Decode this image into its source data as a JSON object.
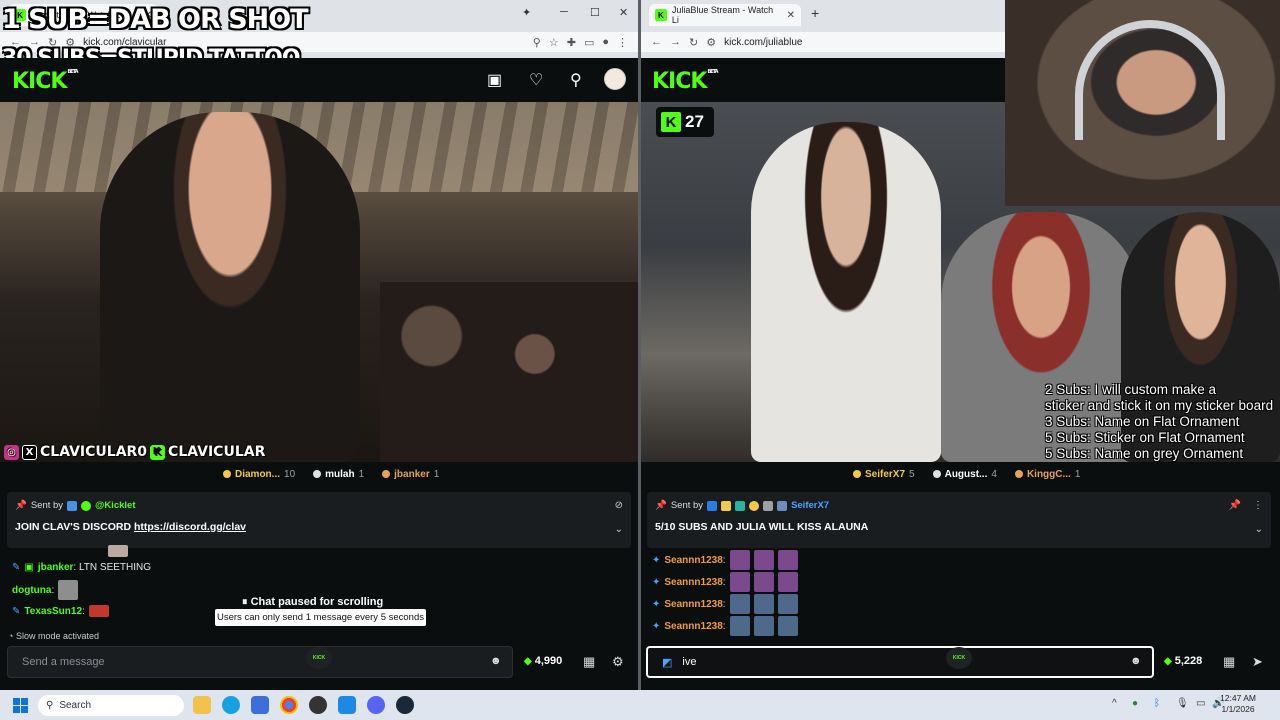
{
  "overlay": {
    "line1": "1 SUB=DAB OR SHOT",
    "line2": "30 SUBS=STUPID TATTOO"
  },
  "left_browser": {
    "tab_title": "Kick Stream - Watch L",
    "url": "kick.com/clavicular"
  },
  "right_browser": {
    "tab_title": "JuliaBlue Stream - Watch Li",
    "url": "kick.com/juliablue"
  },
  "kick": {
    "logo": "KICK",
    "beta": "BETA"
  },
  "left_stream": {
    "socials": "CLAVICULAR0",
    "socials2": "CLAVICULAR",
    "leaderboard": [
      {
        "name": "Diamon...",
        "count": "10",
        "color": "#f2c94c"
      },
      {
        "name": "mulah",
        "count": "1",
        "color": "#e0e0e0"
      },
      {
        "name": "jbanker",
        "count": "1",
        "color": "#e6a15a"
      }
    ],
    "pinned": {
      "sent_by": "Sent by",
      "user": "@Kicklet",
      "message": "JOIN CLAV'S DISCORD ",
      "link": "https://discord.gg/clav"
    },
    "chat": [
      {
        "user": "jbanker",
        "text": ": LTN SEETHING",
        "color": "#53fc18"
      },
      {
        "user": "dogtuna",
        "text": ":",
        "color": "#53fc18"
      },
      {
        "user": "TexasSun12",
        "text": ":",
        "color": "#53fc18"
      }
    ],
    "paused": "Chat paused for scrolling",
    "tooltip": "Users can only send 1 message every 5 seconds",
    "slow_mode": "Slow mode activated",
    "input_placeholder": "Send a message",
    "points": "4,990"
  },
  "right_stream": {
    "viewers": "27",
    "goals": [
      "2 Subs: I will custom make a",
      "sticker and stick it on my sticker board",
      "3 Subs: Name on Flat Ornament",
      "5 Subs: Sticker on Flat Ornament",
      "5 Subs: Name on grey Ornament"
    ],
    "leaderboard": [
      {
        "name": "SeiferX7",
        "count": "5",
        "color": "#f2c94c"
      },
      {
        "name": "August...",
        "count": "4",
        "color": "#e0e0e0"
      },
      {
        "name": "KinggC...",
        "count": "1",
        "color": "#e6a15a"
      }
    ],
    "pinned": {
      "sent_by": "Sent by",
      "user": "SeiferX7",
      "message": "5/10 SUBS AND JULIA WILL KISS ALAUNA"
    },
    "chat": [
      {
        "user": "Seannn1238",
        "text": ":"
      },
      {
        "user": "Seannn1238",
        "text": ":"
      },
      {
        "user": "Seannn1238",
        "text": ":"
      },
      {
        "user": "Seannn1238",
        "text": ":"
      }
    ],
    "input_value": "ive",
    "points": "5,228"
  },
  "taskbar": {
    "search": "Search",
    "time": "12:47 AM",
    "date": "1/1/2026"
  }
}
